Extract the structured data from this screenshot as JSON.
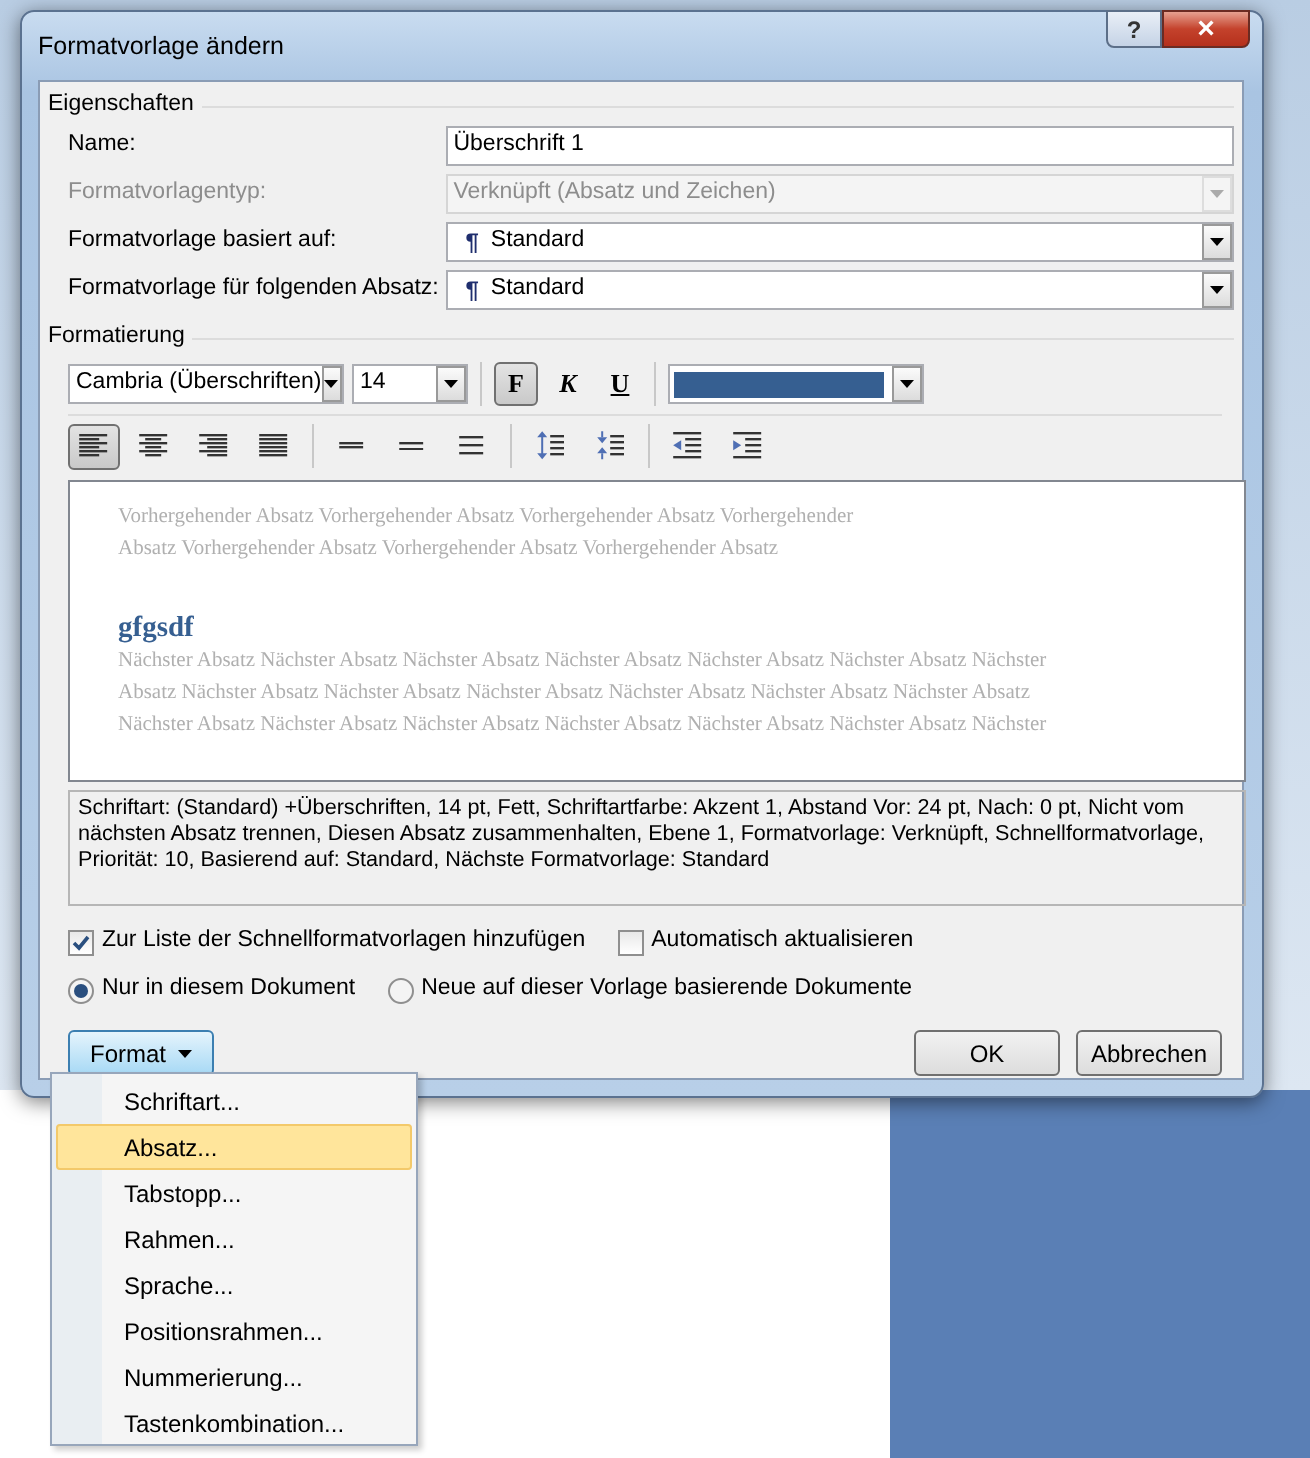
{
  "window": {
    "title": "Formatvorlage ändern",
    "help_button": "?",
    "close_button": "×"
  },
  "properties": {
    "heading": "Eigenschaften",
    "fields": [
      {
        "kind": "text",
        "label": "Name:",
        "value": "Überschrift 1",
        "disabled": false
      },
      {
        "kind": "combo",
        "label": "Formatvorlagentyp:",
        "value": "Verknüpft (Absatz und Zeichen)",
        "disabled": true
      },
      {
        "kind": "combo",
        "label": "Formatvorlage basiert auf:",
        "mark": "¶",
        "value": "Standard",
        "disabled": false
      },
      {
        "kind": "combo",
        "label": "Formatvorlage für folgenden Absatz:",
        "mark": "¶",
        "value": "Standard",
        "disabled": false
      }
    ]
  },
  "formatting": {
    "heading": "Formatierung",
    "font": "Cambria (Überschriften)",
    "size": "14",
    "styles": [
      {
        "kind": "bold",
        "label": "F",
        "selected": true
      },
      {
        "kind": "italic",
        "label": "K",
        "selected": false
      },
      {
        "kind": "underline",
        "label": "U",
        "selected": false
      }
    ],
    "font_color": {
      "color": "#365f91"
    },
    "paragraph_tools": [
      {
        "kind": "align-left",
        "selected": true
      },
      {
        "kind": "align-center",
        "selected": false
      },
      {
        "kind": "align-right",
        "selected": false
      },
      {
        "kind": "justify",
        "selected": false
      },
      {
        "kind": "sep"
      },
      {
        "kind": "single",
        "selected": false
      },
      {
        "kind": "onehalf",
        "selected": false
      },
      {
        "kind": "double",
        "selected": false
      },
      {
        "kind": "sep"
      },
      {
        "kind": "space-more",
        "selected": false
      },
      {
        "kind": "space-less",
        "selected": false
      },
      {
        "kind": "sep"
      },
      {
        "kind": "outdent",
        "selected": false
      },
      {
        "kind": "indent",
        "selected": false
      }
    ]
  },
  "preview": {
    "previous_lines": [
      "Vorhergehender Absatz Vorhergehender Absatz Vorhergehender Absatz Vorhergehender",
      "Absatz Vorhergehender Absatz Vorhergehender Absatz Vorhergehender Absatz"
    ],
    "sample": "gfgsdf",
    "next_lines": [
      "Nächster Absatz Nächster Absatz Nächster Absatz Nächster Absatz Nächster Absatz Nächster Absatz Nächster",
      "Absatz Nächster Absatz Nächster Absatz Nächster Absatz Nächster Absatz Nächster Absatz Nächster Absatz",
      "Nächster Absatz Nächster Absatz Nächster Absatz Nächster Absatz Nächster Absatz Nächster Absatz Nächster"
    ]
  },
  "description": "Schriftart: (Standard) +Überschriften, 14 pt, Fett, Schriftartfarbe: Akzent 1, Abstand Vor:  24 pt, Nach:  0 pt, Nicht vom nächsten Absatz trennen, Diesen Absatz zusammenhalten, Ebene 1, Formatvorlage: Verknüpft, Schnellformatvorlage, Priorität: 10, Basierend auf: Standard, Nächste Formatvorlage: Standard",
  "checkboxes": [
    {
      "label": "Zur Liste der Schnellformatvorlagen hinzufügen",
      "checked": true
    },
    {
      "label": "Automatisch aktualisieren",
      "checked": false
    }
  ],
  "radios": [
    {
      "label": "Nur in diesem Dokument",
      "selected": true
    },
    {
      "label": "Neue auf dieser Vorlage basierende Dokumente",
      "selected": false
    }
  ],
  "format_button": "Format",
  "buttons": [
    "OK",
    "Abbrechen"
  ],
  "menu": [
    {
      "label": "Schriftart...",
      "selected": false
    },
    {
      "label": "Absatz...",
      "selected": true
    },
    {
      "label": "Tabstopp...",
      "selected": false
    },
    {
      "label": "Rahmen...",
      "selected": false
    },
    {
      "label": "Sprache...",
      "selected": false
    },
    {
      "label": "Positionsrahmen...",
      "selected": false
    },
    {
      "label": "Nummerierung...",
      "selected": false
    },
    {
      "label": "Tastenkombination...",
      "selected": false
    }
  ]
}
